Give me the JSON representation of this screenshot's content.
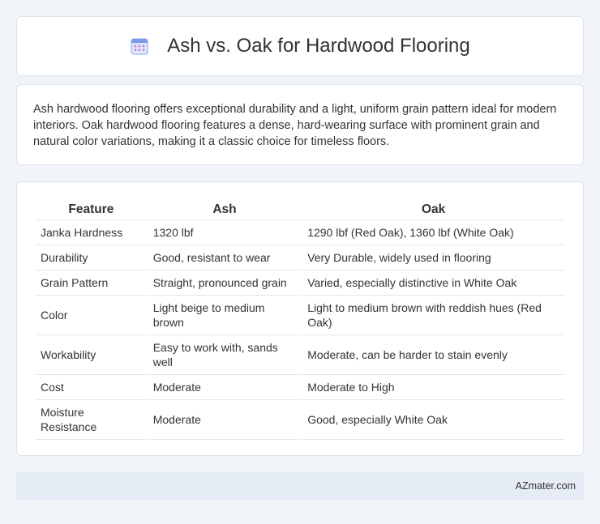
{
  "header": {
    "title": "Ash vs. Oak for Hardwood Flooring",
    "icon": "calendar-icon",
    "icon_color": "#6b8fe0",
    "icon_accent": "#c86ad8"
  },
  "intro": {
    "text": "Ash hardwood flooring offers exceptional durability and a light, uniform grain pattern ideal for modern interiors. Oak hardwood flooring features a dense, hard-wearing surface with prominent grain and natural color variations, making it a classic choice for timeless floors."
  },
  "table": {
    "headers": [
      "Feature",
      "Ash",
      "Oak"
    ],
    "rows": [
      [
        "Janka Hardness",
        "1320 lbf",
        "1290 lbf (Red Oak), 1360 lbf (White Oak)"
      ],
      [
        "Durability",
        "Good, resistant to wear",
        "Very Durable, widely used in flooring"
      ],
      [
        "Grain Pattern",
        "Straight, pronounced grain",
        "Varied, especially distinctive in White Oak"
      ],
      [
        "Color",
        "Light beige to medium brown",
        "Light to medium brown with reddish hues (Red Oak)"
      ],
      [
        "Workability",
        "Easy to work with, sands well",
        "Moderate, can be harder to stain evenly"
      ],
      [
        "Cost",
        "Moderate",
        "Moderate to High"
      ],
      [
        "Moisture Resistance",
        "Moderate",
        "Good, especially White Oak"
      ]
    ]
  },
  "footer": {
    "text": "AZmater.com"
  }
}
